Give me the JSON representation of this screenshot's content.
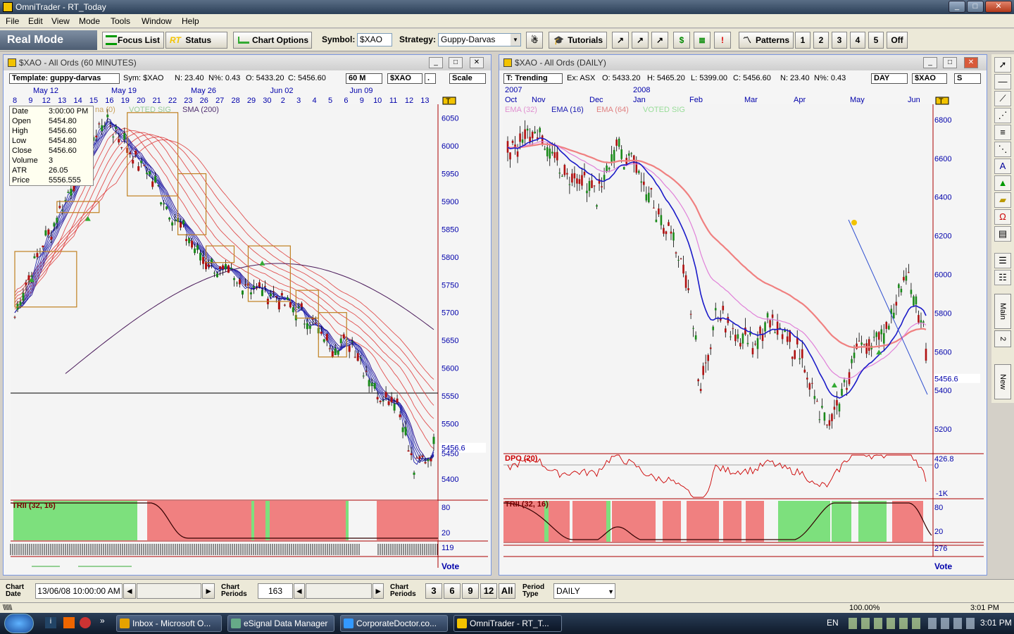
{
  "window": {
    "title": "OmniTrader - RT_Today",
    "min": "_",
    "max": "□",
    "close": "✕"
  },
  "menu": [
    "File",
    "Edit",
    "View",
    "Mode",
    "Tools",
    "Window",
    "Help"
  ],
  "toolbar": {
    "mode": "Real Mode",
    "focus_list": "Focus List",
    "status": "Status",
    "chart_options": "Chart Options",
    "symbol_label": "Symbol:",
    "symbol_value": "$XAO",
    "strategy_label": "Strategy:",
    "strategy_value": "Guppy-Darvas",
    "tutorials": "Tutorials",
    "patterns": "Patterns",
    "nums": [
      "1",
      "2",
      "3",
      "4",
      "5"
    ],
    "off": "Off"
  },
  "left_chart": {
    "title": "$XAO - All Ords (60 MINUTES)",
    "template": "Template: guppy-darvas",
    "sym": "Sym: $XAO",
    "n": "N: 23.40",
    "npct": "N%: 0.43",
    "o": "O: 5433.20",
    "c": "C: 5456.60",
    "period": "60 M",
    "symdd": "$XAO",
    "dot": ".",
    "scale": "Scale",
    "months": [
      "May 12",
      "May 19",
      "May 26",
      "Jun 02",
      "Jun 09"
    ],
    "days": [
      "8",
      "9",
      "12",
      "13",
      "14",
      "15",
      "16",
      "19",
      "20",
      "21",
      "22",
      "23",
      "26",
      "27",
      "28",
      "29",
      "30",
      "2",
      "3",
      "4",
      "5",
      "6",
      "9",
      "10",
      "11",
      "12",
      "13"
    ],
    "prices": [
      "6050",
      "6000",
      "5950",
      "5900",
      "5850",
      "5800",
      "5750",
      "5700",
      "5650",
      "5600",
      "5550",
      "5500",
      "5450",
      "5400"
    ],
    "last_price": "5456.6",
    "partial_price": "5450",
    "legend": [
      "na (0)",
      "VOTED SIG",
      "SMA (200)"
    ],
    "datawin": [
      [
        "Date",
        "3:00:00 PM"
      ],
      [
        "Open",
        "5454.80"
      ],
      [
        "High",
        "5456.60"
      ],
      [
        "Low",
        "5454.80"
      ],
      [
        "Close",
        "5456.60"
      ],
      [
        "Volume",
        "3"
      ],
      [
        "ATR",
        "26.05"
      ],
      [
        "Price",
        "5556.555"
      ]
    ],
    "trii": "TRII (32, 16)",
    "trii_80": "80",
    "trii_20": "20",
    "vol": "119",
    "vote": "Vote"
  },
  "right_chart": {
    "title": "$XAO - All Ords (DAILY)",
    "template": "T: Trending",
    "ex": "Ex: ASX",
    "o": "O: 5433.20",
    "h": "H: 5465.20",
    "l": "L: 5399.00",
    "c": "C: 5456.60",
    "n": "N: 23.40",
    "npct": "N%: 0.43",
    "period": "DAY",
    "symdd": "$XAO",
    "s": "S",
    "years": [
      "2007",
      "2008"
    ],
    "months": [
      "Oct",
      "Nov",
      "Dec",
      "Jan",
      "Feb",
      "Mar",
      "Apr",
      "May",
      "Jun"
    ],
    "prices": [
      "6800",
      "6600",
      "6400",
      "6200",
      "6000",
      "5800",
      "5600",
      "5456.6",
      "5400",
      "5200"
    ],
    "legend": [
      "EMA (32)",
      "EMA (16)",
      "EMA (64)",
      "VOTED SIG"
    ],
    "dpo": "DPO (20)",
    "dpo_vals": [
      "426.8",
      "0",
      "-1K"
    ],
    "trii": "TRII (32, 16)",
    "trii_80": "80",
    "trii_20": "20",
    "vol": "276",
    "vote": "Vote"
  },
  "sidebar": {
    "tabs": [
      "Main",
      "2",
      "New"
    ]
  },
  "bottom": {
    "chart_date_label": "Chart Date",
    "chart_date": "13/06/08 10:00:00 AM",
    "chart_periods_label": "Chart Periods",
    "chart_periods": "163",
    "chart_periods2_label": "Chart Periods",
    "periods": [
      "3",
      "6",
      "9",
      "12",
      "All"
    ],
    "period_type_label": "Period Type",
    "period_type": "DAILY"
  },
  "status": {
    "zoom": "100.00%",
    "time": "3:01 PM"
  },
  "taskbar": {
    "items": [
      "Inbox - Microsoft O...",
      "eSignal Data Manager",
      "CorporateDoctor.co...",
      "OmniTrader - RT_T..."
    ],
    "lang": "EN",
    "clock": "3:01 PM"
  }
}
